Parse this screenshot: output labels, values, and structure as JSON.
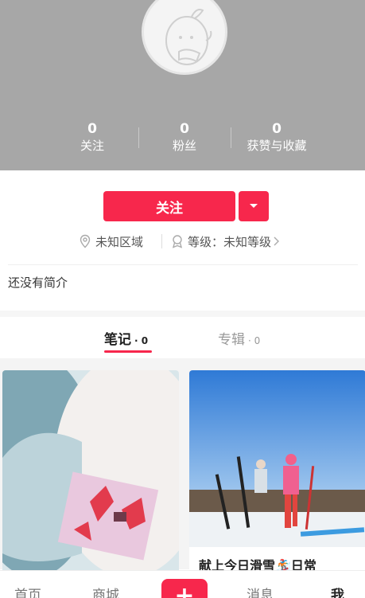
{
  "profile": {
    "stats": [
      {
        "count": "0",
        "label": "关注"
      },
      {
        "count": "0",
        "label": "粉丝"
      },
      {
        "count": "0",
        "label": "获赞与收藏"
      }
    ],
    "follow_label": "关注",
    "location": "未知区域",
    "level": "等级：未知等级",
    "bio": "还没有简介"
  },
  "tabs": [
    {
      "label": "笔记",
      "count": "· 0"
    },
    {
      "label": "专辑",
      "count": "· 0"
    }
  ],
  "cards": [
    {
      "caption": ""
    },
    {
      "caption": "献上今日滑雪🏂日常"
    }
  ],
  "bottom_nav": {
    "items": [
      "首页",
      "商城",
      "消息",
      "我"
    ],
    "add": "+"
  },
  "colors": {
    "accent": "#f7274c",
    "header_bg": "#a7a7a7"
  }
}
